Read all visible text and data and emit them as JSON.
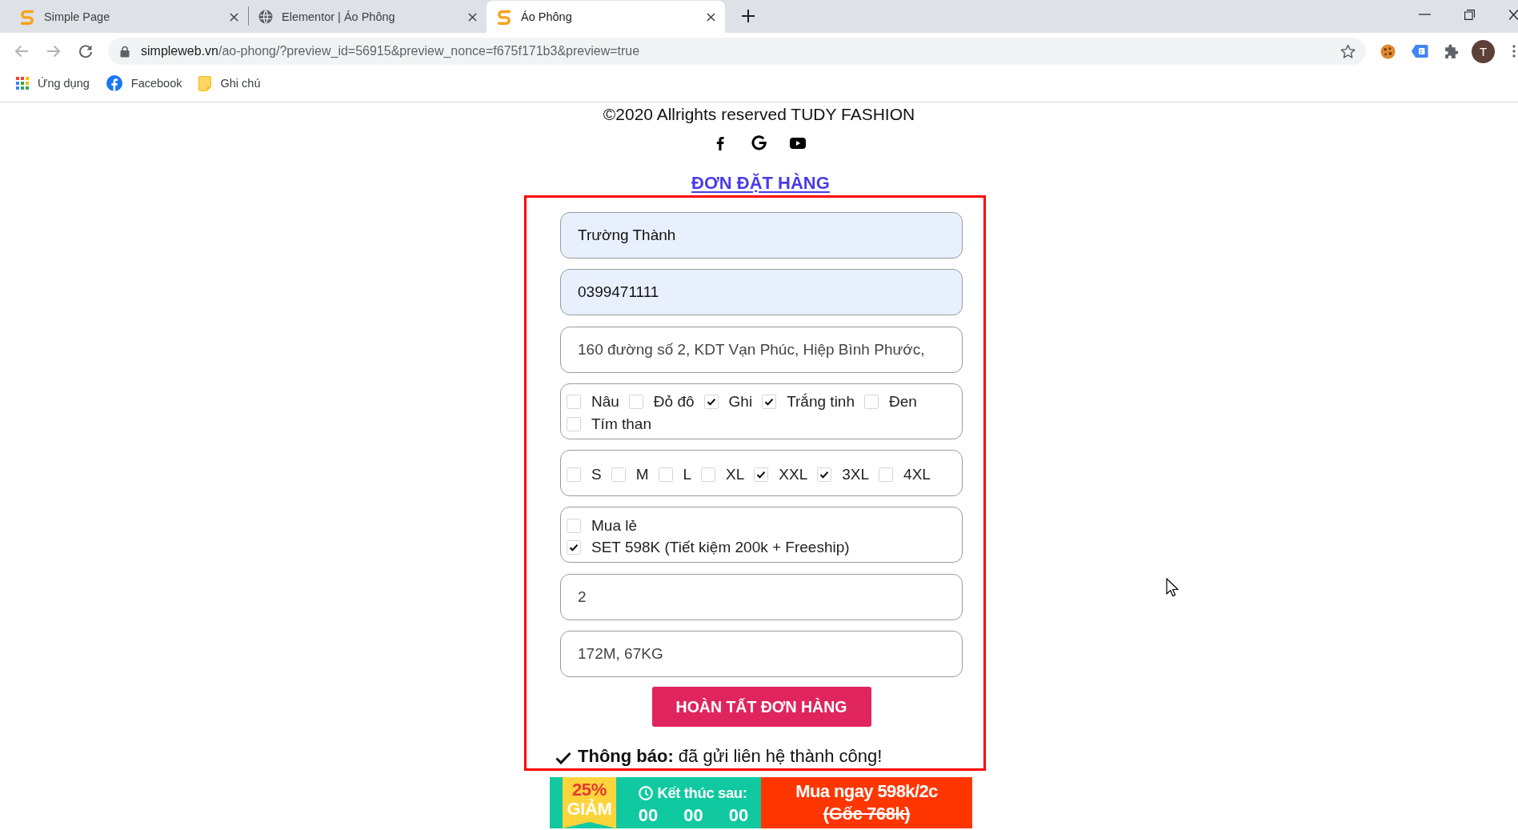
{
  "browser": {
    "tabs": [
      {
        "title": "Simple Page",
        "kind": "logo",
        "selected": false
      },
      {
        "title": "Elementor | Áo Phông",
        "kind": "globe",
        "selected": false
      },
      {
        "title": "Áo Phông",
        "kind": "logo",
        "selected": true
      }
    ],
    "address_bar": {
      "host": "simpleweb.vn",
      "path": "/ao-phong/?preview_id=56915&preview_nonce=f675f171b3&preview=true"
    },
    "profile": {
      "initial": "T"
    },
    "bookmarks": [
      {
        "label": "Ứng dụng",
        "kind": "apps"
      },
      {
        "label": "Facebook",
        "kind": "site"
      },
      {
        "label": "Ghi chú",
        "kind": "folder"
      }
    ]
  },
  "page": {
    "copyright": "©2020 Allrights reserved TUDY FASHION",
    "order_title": "ĐƠN ĐẶT HÀNG",
    "form": {
      "fields": [
        {
          "kind": "text",
          "value": "Trường Thành",
          "autofilled": true
        },
        {
          "kind": "text",
          "value": "0399471111",
          "autofilled": true
        },
        {
          "kind": "text",
          "value": "160 đường số 2, KDT Vạn Phúc, Hiệp Bình Phước,",
          "autofilled": false
        },
        {
          "kind": "checkbox_row",
          "options": [
            {
              "label": "Nâu",
              "checked": false
            },
            {
              "label": "Đỏ đô",
              "checked": false
            },
            {
              "label": "Ghi",
              "checked": true
            },
            {
              "label": "Trắng tinh",
              "checked": true
            },
            {
              "label": "Đen",
              "checked": false
            },
            {
              "label": "Tím than",
              "checked": false
            }
          ]
        },
        {
          "kind": "checkbox_row",
          "options": [
            {
              "label": "S",
              "checked": false
            },
            {
              "label": "M",
              "checked": false
            },
            {
              "label": "L",
              "checked": false
            },
            {
              "label": "XL",
              "checked": false
            },
            {
              "label": "XXL",
              "checked": true
            },
            {
              "label": "3XL",
              "checked": true
            },
            {
              "label": "4XL",
              "checked": false
            }
          ]
        },
        {
          "kind": "checkbox_list",
          "options": [
            {
              "label": "Mua lẻ",
              "checked": false
            },
            {
              "label": "SET 598K (Tiết kiệm 200k + Freeship)",
              "checked": true
            }
          ]
        },
        {
          "kind": "text",
          "value": "2",
          "autofilled": false
        },
        {
          "kind": "text",
          "value": "172M, 67KG",
          "autofilled": false
        }
      ],
      "submit": "HOÀN TẤT ĐƠN HÀNG",
      "notice": "**Thông báo:** đã gửi liên hệ thành công!"
    },
    "promo_bar": {
      "discount": "25%",
      "discount_label": "GIẢM",
      "countdown_label": "Kết thúc sau:",
      "countdown": [
        "00",
        "00",
        "00"
      ],
      "offer": "Mua ngay 598k/2c",
      "original_price": "(Gốc 768k)"
    }
  }
}
